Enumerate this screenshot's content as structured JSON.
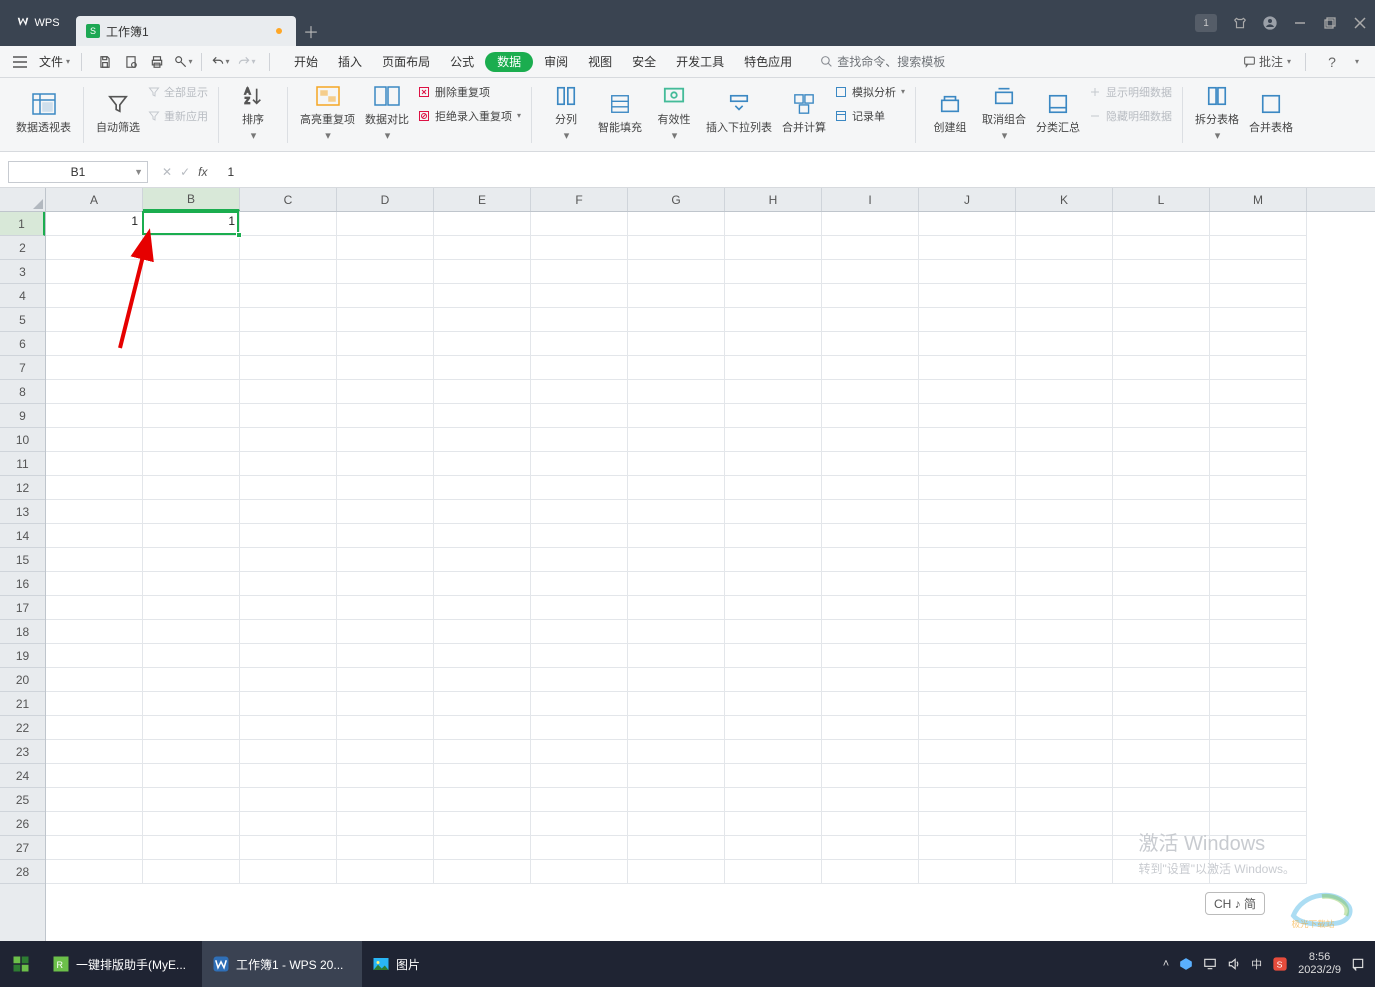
{
  "titlebar": {
    "app_name": "WPS",
    "tab_label": "工作簿1",
    "badge": "1"
  },
  "menubar": {
    "file": "文件",
    "tabs": [
      "开始",
      "插入",
      "页面布局",
      "公式",
      "数据",
      "审阅",
      "视图",
      "安全",
      "开发工具",
      "特色应用"
    ],
    "active_tab_index": 4,
    "search_placeholder": "查找命令、搜索模板",
    "annotate": "批注"
  },
  "ribbon": {
    "pivot": "数据透视表",
    "autofilter": "自动筛选",
    "show_all": "全部显示",
    "reapply": "重新应用",
    "sort": "排序",
    "highlight_dup": "高亮重复项",
    "data_compare": "数据对比",
    "remove_dup": "删除重复项",
    "reject_dup": "拒绝录入重复项",
    "text_to_cols": "分列",
    "smart_fill": "智能填充",
    "validation": "有效性",
    "insert_dropdown": "插入下拉列表",
    "consolidate": "合并计算",
    "whatif": "模拟分析",
    "record_form": "记录单",
    "group": "创建组",
    "ungroup": "取消组合",
    "subtotal": "分类汇总",
    "show_detail": "显示明细数据",
    "hide_detail": "隐藏明细数据",
    "split_table": "拆分表格",
    "merge_tables": "合并表格"
  },
  "formula_bar": {
    "cell_ref": "B1",
    "fx_label": "fx",
    "value": "1"
  },
  "grid": {
    "columns": [
      "A",
      "B",
      "C",
      "D",
      "E",
      "F",
      "G",
      "H",
      "I",
      "J",
      "K",
      "L",
      "M"
    ],
    "rows": 28,
    "active_col": 1,
    "active_row": 0,
    "cells": {
      "A1": "1",
      "B1": "1"
    }
  },
  "watermark": {
    "line1": "激活 Windows",
    "line2": "转到\"设置\"以激活 Windows。"
  },
  "ime": "CH ♪ 简",
  "taskbar": {
    "items": [
      {
        "label": "一键排版助手(MyE..."
      },
      {
        "label": "工作簿1 - WPS 20..."
      },
      {
        "label": "图片"
      }
    ],
    "time": "8:56",
    "date": "2023/2/9",
    "ime_short": "中"
  }
}
